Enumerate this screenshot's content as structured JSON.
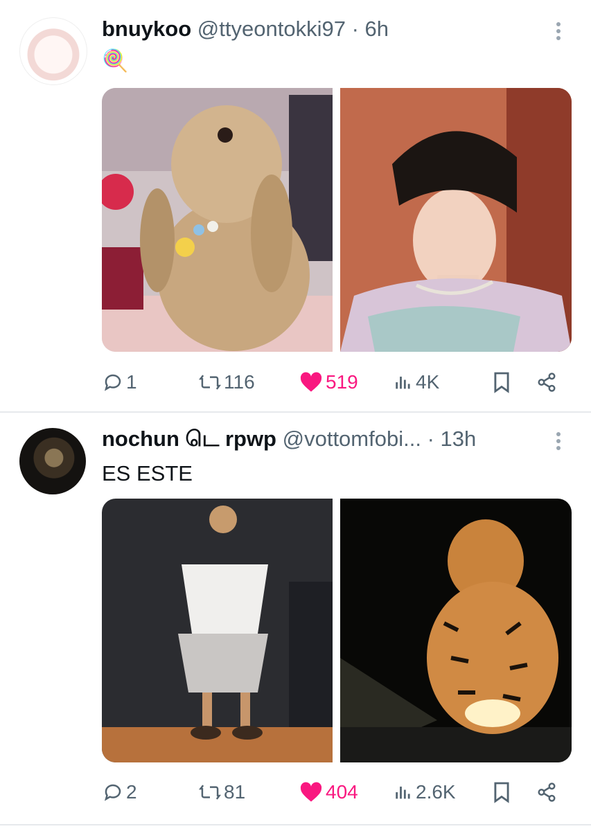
{
  "tweets": [
    {
      "name": "bnuykoo",
      "handle": "@ttyeontokki97",
      "separator": "·",
      "time": "6h",
      "text": "🍭",
      "media": [
        "bunny-photo",
        "person-photo"
      ],
      "replies": "1",
      "retweets": "116",
      "likes": "519",
      "views": "4K"
    },
    {
      "name": "nochun டெ rpwp",
      "handle": "@vottomfobi...",
      "separator": "·",
      "time": "13h",
      "text": "ES ESTE",
      "media": [
        "dancer-photo",
        "tiger-photo"
      ],
      "replies": "2",
      "retweets": "81",
      "likes": "404",
      "views": "2.6K"
    }
  ],
  "colors": {
    "like": "#f91880",
    "muted": "#536471",
    "text": "#0f1419",
    "divider": "#e6e9ec"
  }
}
